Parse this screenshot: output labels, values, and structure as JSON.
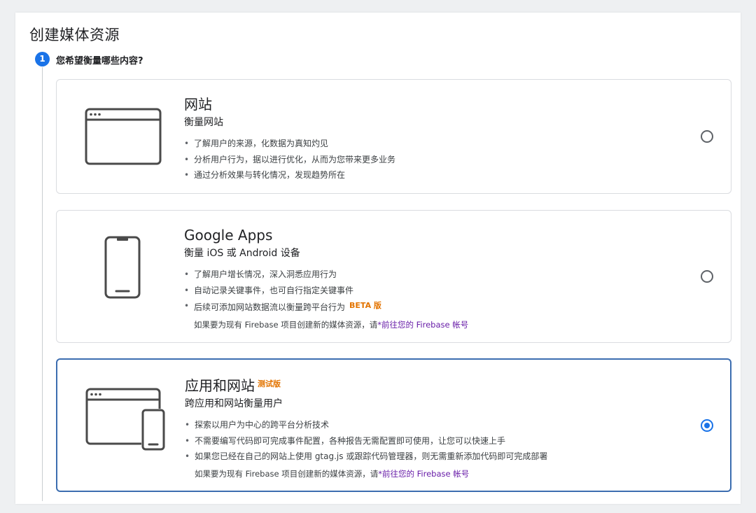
{
  "page": {
    "title": "创建媒体资源"
  },
  "step": {
    "number": "1",
    "title": "您希望衡量哪些内容?"
  },
  "cards": [
    {
      "title": "网站",
      "subtitle": "衡量网站",
      "icon": "browser-window-icon",
      "bullets": [
        "了解用户的来源，化数据为真知灼见",
        "分析用户行为，据以进行优化，从而为您带来更多业务",
        "通过分析效果与转化情况，发现趋势所在"
      ],
      "selected": false
    },
    {
      "title": "Google Apps",
      "subtitle": "衡量 iOS 或 Android 设备",
      "icon": "phone-icon",
      "bullets": [
        "了解用户增长情况，深入洞悉应用行为",
        "自动记录关键事件，也可自行指定关键事件",
        "后续可添加网站数据流以衡量跨平台行为"
      ],
      "beta_label": "BETA 版",
      "note_prefix": "如果要为现有 Firebase 项目创建新的媒体资源，请",
      "note_link": "前往您的 Firebase 帐号",
      "selected": false
    },
    {
      "title": "应用和网站",
      "title_badge": "测试版",
      "subtitle": "跨应用和网站衡量用户",
      "icon": "browser-and-phone-icon",
      "bullets": [
        "探索以用户为中心的跨平台分析技术",
        "不需要编写代码即可完成事件配置，各种报告无需配置即可使用，让您可以快速上手",
        "如果您已经在自己的网站上使用 gtag.js 或跟踪代码管理器，则无需重新添加代码即可完成部署"
      ],
      "note_prefix": "如果要为现有 Firebase 项目创建新的媒体资源，请",
      "note_link": "前往您的 Firebase 帐号",
      "selected": true
    }
  ],
  "colors": {
    "accent": "#1a73e8",
    "selected_border": "#3c6db0",
    "badge": "#e37400",
    "link": "#681da8"
  }
}
